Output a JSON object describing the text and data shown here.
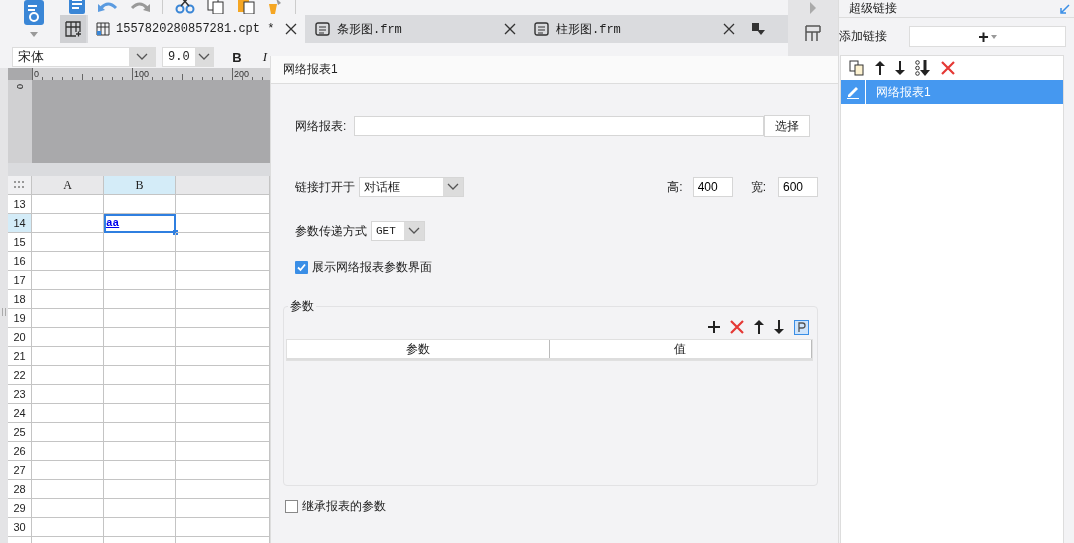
{
  "toolbar": {
    "font": "宋体",
    "size": "9.0",
    "bold": "B",
    "italic": "I"
  },
  "tabs": [
    {
      "label": "1557820280857281.cpt *",
      "kind": "cpt",
      "selected": true
    },
    {
      "label": "条形图.frm",
      "kind": "frm",
      "selected": false
    },
    {
      "label": "柱形图.frm",
      "kind": "frm",
      "selected": false
    }
  ],
  "ruler": {
    "marks": [
      "0",
      "100",
      "200"
    ],
    "vertical_mark": "0"
  },
  "sheet": {
    "columns": [
      {
        "label": "A",
        "selected": false
      },
      {
        "label": "B",
        "selected": true
      }
    ],
    "rows": [
      {
        "label": "13",
        "selected": false
      },
      {
        "label": "14",
        "selected": true,
        "cell_b": "aa"
      },
      {
        "label": "15",
        "selected": false
      },
      {
        "label": "16",
        "selected": false
      },
      {
        "label": "17",
        "selected": false
      },
      {
        "label": "18",
        "selected": false
      },
      {
        "label": "19",
        "selected": false
      },
      {
        "label": "20",
        "selected": false
      },
      {
        "label": "21",
        "selected": false
      },
      {
        "label": "22",
        "selected": false
      },
      {
        "label": "23",
        "selected": false
      },
      {
        "label": "24",
        "selected": false
      },
      {
        "label": "25",
        "selected": false
      },
      {
        "label": "26",
        "selected": false
      },
      {
        "label": "27",
        "selected": false
      },
      {
        "label": "28",
        "selected": false
      },
      {
        "label": "29",
        "selected": false
      },
      {
        "label": "30",
        "selected": false
      }
    ]
  },
  "dialog": {
    "title": "网络报表1",
    "report_label": "网络报表:",
    "choose_button": "选择",
    "open_label": "链接打开于",
    "open_value": "对话框",
    "height_label": "高:",
    "height_value": "400",
    "width_label": "宽:",
    "width_value": "600",
    "method_label": "参数传递方式",
    "method_value": "GET",
    "show_params": {
      "label": "展示网络报表参数界面",
      "checked": true
    },
    "params": {
      "title": "参数",
      "columns": [
        "参数",
        "值"
      ]
    },
    "inherit": {
      "label": "继承报表的参数",
      "checked": false
    }
  },
  "panel": {
    "title": "超级链接",
    "add_label": "添加链接",
    "add_button": "+",
    "links": [
      {
        "label": "网络报表1",
        "selected": true
      }
    ]
  }
}
